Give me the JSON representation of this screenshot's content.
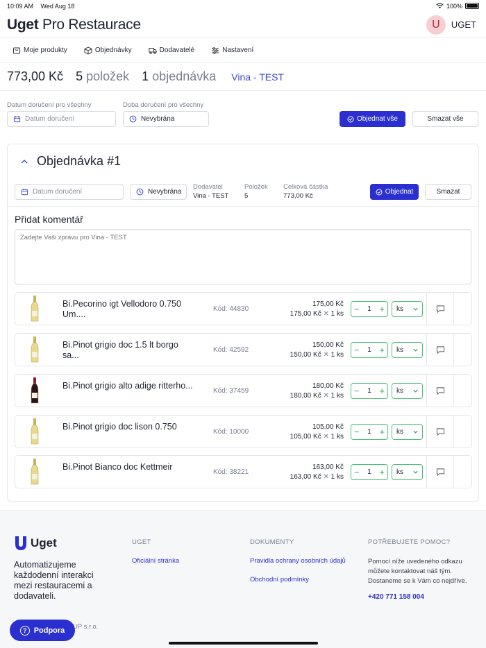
{
  "status": {
    "time": "10:09 AM",
    "date": "Wed Aug 18",
    "battery": "100%"
  },
  "app": {
    "title_bold": "Uget",
    "title_rest": " Pro Restaurace"
  },
  "user": {
    "initial": "U",
    "name": "UGET"
  },
  "nav": [
    {
      "label": "Moje produkty",
      "icon": "cart-icon"
    },
    {
      "label": "Objednávky",
      "icon": "box-icon"
    },
    {
      "label": "Dodavatelé",
      "icon": "truck-icon"
    },
    {
      "label": "Nastavení",
      "icon": "sliders-icon"
    }
  ],
  "summary": {
    "total": "773,00 Kč",
    "items_num": "5",
    "items_label": "položek",
    "orders_num": "1",
    "orders_label": "objednávka",
    "supplier": "Vina - TEST"
  },
  "global": {
    "date_label": "Datum doručení pro všechny",
    "date_placeholder": "Datum doručení",
    "time_label": "Doba doručení pro všechny",
    "time_value": "Nevybrána",
    "order_all": "Objednat vše",
    "delete_all": "Smazat vše"
  },
  "order": {
    "title": "Objednávka #1",
    "date_placeholder": "Datum doručení",
    "time_value": "Nevybrána",
    "supplier_label": "Dodavatel",
    "supplier_value": "Vina - TEST",
    "items_label": "Položek",
    "items_value": "5",
    "amount_label": "Celková částka",
    "amount_value": "773,00 Kč",
    "order_btn": "Objednat",
    "delete_btn": "Smazat",
    "comment_title": "Přidat komentář",
    "comment_placeholder": "Zadejte Vaši zprávu pro Vina - TEST"
  },
  "products": [
    {
      "name": "Bi.Pecorino igt Vellodoro 0.750 Um....",
      "code": "Kód: 44830",
      "total": "175,00 Kč",
      "unit_price": "175,00 Kč",
      "qty_note": "1 ks",
      "qty": "1",
      "unit": "ks",
      "wine": "white"
    },
    {
      "name": "Bi.Pinot grigio doc 1.5 lt borgo sa...",
      "code": "Kód: 42592",
      "total": "150,00 Kč",
      "unit_price": "150,00 Kč",
      "qty_note": "1 ks",
      "qty": "1",
      "unit": "ks",
      "wine": "white"
    },
    {
      "name": "Bi.Pinot grigio alto adige ritterho...",
      "code": "Kód: 37459",
      "total": "180,00 Kč",
      "unit_price": "180,00 Kč",
      "qty_note": "1 ks",
      "qty": "1",
      "unit": "ks",
      "wine": "red"
    },
    {
      "name": "Bi.Pinot grigio doc lison 0.750",
      "code": "Kód: 10000",
      "total": "105,00 Kč",
      "unit_price": "105,00 Kč",
      "qty_note": "1 ks",
      "qty": "1",
      "unit": "ks",
      "wine": "white"
    },
    {
      "name": "Bi.Pinot Bianco doc Kettmeir",
      "code": "Kód: 38221",
      "total": "163,00 Kč",
      "unit_price": "163,00 Kč",
      "qty_note": "1 ks",
      "qty": "1",
      "unit": "ks",
      "wine": "white"
    }
  ],
  "footer": {
    "brand": "Uget",
    "tagline": "Automatizujeme každodenní interakci mezi restauracemi a dodavateli.",
    "col1_head": "UGET",
    "col1_link": "Oficiální stránka",
    "col2_head": "DOKUMENTY",
    "col2_link1": "Pravidla ochrany osobních údajů",
    "col2_link2": "Obchodní podmínky",
    "col3_head": "POTŘEBUJETE POMOC?",
    "col3_text": "Pomocí níže uvedeného odkazu můžete kontaktovat náš tým. Dostaneme se k Vám co nejdříve.",
    "col3_phone": "+420 771 158 004",
    "company": "UP s.r.o."
  },
  "support": {
    "label": "Podpora"
  },
  "colors": {
    "primary": "#2b2fd0",
    "accent_green": "#4cc27a",
    "avatar_bg": "#f7cfd3"
  }
}
